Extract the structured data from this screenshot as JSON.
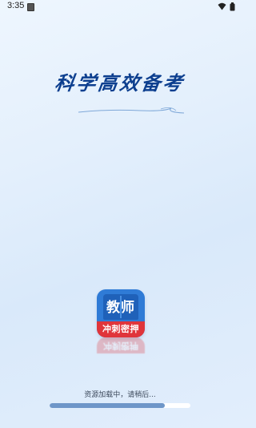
{
  "status_bar": {
    "time": "3:35",
    "notification_icon": "a-notification-icon",
    "wifi_icon": "wifi-icon",
    "battery_icon": "battery-icon"
  },
  "splash": {
    "slogan": "科学高效备考",
    "logo": {
      "title": "教师",
      "ribbon": "冲刺密押",
      "primary_color": "#2f7bd6",
      "ribbon_color": "#e0353b"
    }
  },
  "loading": {
    "text": "资源加载中，请稍后...",
    "progress": 0.82,
    "fill_color": "#6e96c8"
  }
}
